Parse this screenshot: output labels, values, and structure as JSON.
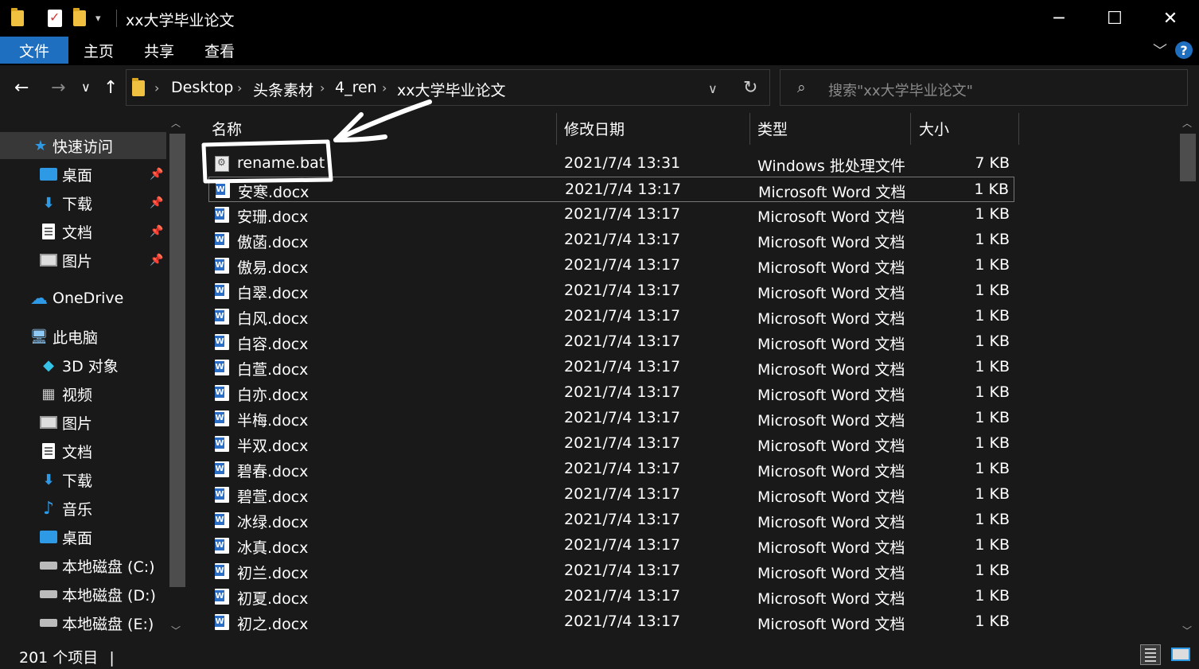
{
  "window": {
    "title": "xx大学毕业论文",
    "minimize": "─",
    "maximize": "☐",
    "close": "✕"
  },
  "ribbon": {
    "tabs": [
      "文件",
      "主页",
      "共享",
      "查看"
    ],
    "help": "?"
  },
  "nav": {
    "breadcrumbs": [
      "Desktop",
      "头条素材",
      "4_ren",
      "xx大学毕业论文"
    ],
    "search_placeholder": "搜索\"xx大学毕业论文\""
  },
  "sidebar": {
    "items": [
      {
        "label": "快速访问",
        "icon": "star-icon"
      },
      {
        "label": "桌面",
        "icon": "desktop-icon",
        "pinned": true
      },
      {
        "label": "下载",
        "icon": "download-icon",
        "pinned": true
      },
      {
        "label": "文档",
        "icon": "documents-icon",
        "pinned": true
      },
      {
        "label": "图片",
        "icon": "pictures-icon",
        "pinned": true
      },
      {
        "label": "OneDrive",
        "icon": "cloud-icon"
      },
      {
        "label": "此电脑",
        "icon": "computer-icon"
      },
      {
        "label": "3D 对象",
        "icon": "3d-objects-icon"
      },
      {
        "label": "视频",
        "icon": "videos-icon"
      },
      {
        "label": "图片",
        "icon": "pictures-icon"
      },
      {
        "label": "文档",
        "icon": "documents-icon"
      },
      {
        "label": "下载",
        "icon": "download-icon"
      },
      {
        "label": "音乐",
        "icon": "music-icon"
      },
      {
        "label": "桌面",
        "icon": "desktop-icon"
      },
      {
        "label": "本地磁盘 (C:)",
        "icon": "disk-icon"
      },
      {
        "label": "本地磁盘 (D:)",
        "icon": "disk-icon"
      },
      {
        "label": "本地磁盘 (E:)",
        "icon": "disk-icon"
      }
    ]
  },
  "columns": [
    "名称",
    "修改日期",
    "类型",
    "大小"
  ],
  "files": [
    {
      "name": "rename.bat",
      "date": "2021/7/4 13:31",
      "type": "Windows 批处理文件",
      "size": "7 KB",
      "icon": "bat"
    },
    {
      "name": "安寒.docx",
      "date": "2021/7/4 13:17",
      "type": "Microsoft Word 文档",
      "size": "1 KB",
      "icon": "word"
    },
    {
      "name": "安珊.docx",
      "date": "2021/7/4 13:17",
      "type": "Microsoft Word 文档",
      "size": "1 KB",
      "icon": "word"
    },
    {
      "name": "傲菡.docx",
      "date": "2021/7/4 13:17",
      "type": "Microsoft Word 文档",
      "size": "1 KB",
      "icon": "word"
    },
    {
      "name": "傲易.docx",
      "date": "2021/7/4 13:17",
      "type": "Microsoft Word 文档",
      "size": "1 KB",
      "icon": "word"
    },
    {
      "name": "白翠.docx",
      "date": "2021/7/4 13:17",
      "type": "Microsoft Word 文档",
      "size": "1 KB",
      "icon": "word"
    },
    {
      "name": "白风.docx",
      "date": "2021/7/4 13:17",
      "type": "Microsoft Word 文档",
      "size": "1 KB",
      "icon": "word"
    },
    {
      "name": "白容.docx",
      "date": "2021/7/4 13:17",
      "type": "Microsoft Word 文档",
      "size": "1 KB",
      "icon": "word"
    },
    {
      "name": "白萱.docx",
      "date": "2021/7/4 13:17",
      "type": "Microsoft Word 文档",
      "size": "1 KB",
      "icon": "word"
    },
    {
      "name": "白亦.docx",
      "date": "2021/7/4 13:17",
      "type": "Microsoft Word 文档",
      "size": "1 KB",
      "icon": "word"
    },
    {
      "name": "半梅.docx",
      "date": "2021/7/4 13:17",
      "type": "Microsoft Word 文档",
      "size": "1 KB",
      "icon": "word"
    },
    {
      "name": "半双.docx",
      "date": "2021/7/4 13:17",
      "type": "Microsoft Word 文档",
      "size": "1 KB",
      "icon": "word"
    },
    {
      "name": "碧春.docx",
      "date": "2021/7/4 13:17",
      "type": "Microsoft Word 文档",
      "size": "1 KB",
      "icon": "word"
    },
    {
      "name": "碧萱.docx",
      "date": "2021/7/4 13:17",
      "type": "Microsoft Word 文档",
      "size": "1 KB",
      "icon": "word"
    },
    {
      "name": "冰绿.docx",
      "date": "2021/7/4 13:17",
      "type": "Microsoft Word 文档",
      "size": "1 KB",
      "icon": "word"
    },
    {
      "name": "冰真.docx",
      "date": "2021/7/4 13:17",
      "type": "Microsoft Word 文档",
      "size": "1 KB",
      "icon": "word"
    },
    {
      "name": "初兰.docx",
      "date": "2021/7/4 13:17",
      "type": "Microsoft Word 文档",
      "size": "1 KB",
      "icon": "word"
    },
    {
      "name": "初夏.docx",
      "date": "2021/7/4 13:17",
      "type": "Microsoft Word 文档",
      "size": "1 KB",
      "icon": "word"
    },
    {
      "name": "初之.docx",
      "date": "2021/7/4 13:17",
      "type": "Microsoft Word 文档",
      "size": "1 KB",
      "icon": "word"
    }
  ],
  "status": {
    "count": "201 个项目"
  },
  "colors": {
    "accent": "#1f6fc0",
    "background": "#191919",
    "titlebar": "#000000"
  }
}
